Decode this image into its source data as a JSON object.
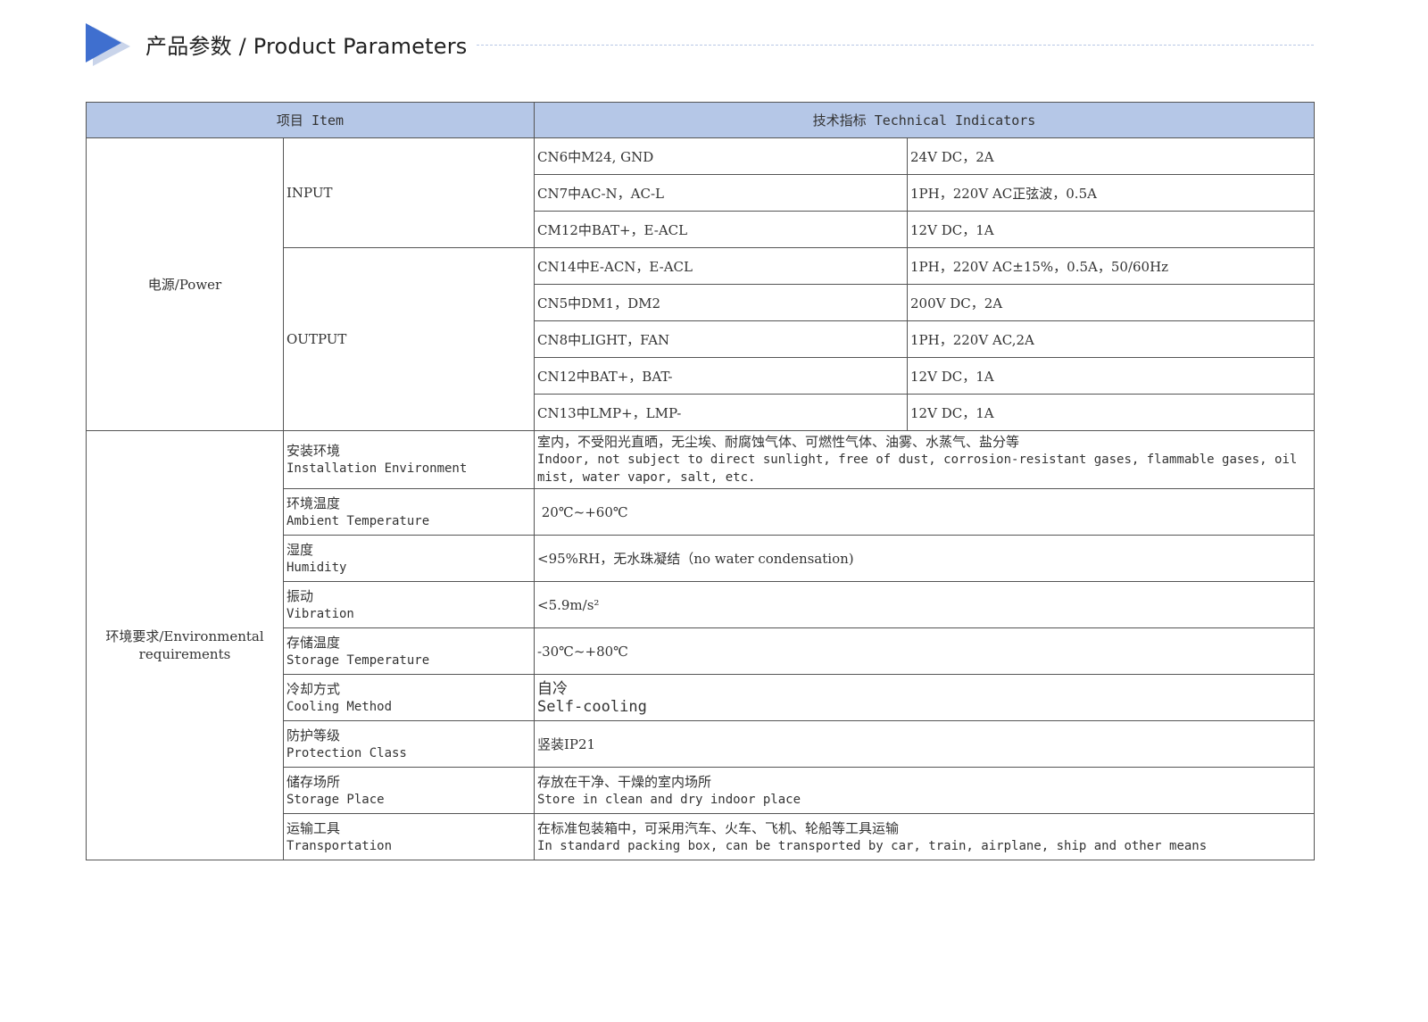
{
  "header": {
    "title": "产品参数 / Product Parameters",
    "accent": "#3f6fcf"
  },
  "table": {
    "col_item": "项目 Item",
    "col_tech": "技术指标 Technical Indicators",
    "header_bg": "#b5c7e7",
    "power": {
      "category": "电源/Power",
      "input_label": "INPUT",
      "output_label": "OUTPUT",
      "input_rows": [
        {
          "port": "CN6中M24, GND",
          "spec": "24V DC，2A"
        },
        {
          "port": "CN7中AC-N，AC-L",
          "spec": "1PH，220V AC正弦波，0.5A"
        },
        {
          "port": "CM12中BAT+，E-ACL",
          "spec": "12V DC，1A"
        }
      ],
      "output_rows": [
        {
          "port": "CN14中E-ACN，E-ACL",
          "spec": "1PH，220V AC±15%，0.5A，50/60Hz"
        },
        {
          "port": "CN5中DM1，DM2",
          "spec": "200V DC，2A"
        },
        {
          "port": "CN8中LIGHT，FAN",
          "spec": "1PH，220V AC,2A"
        },
        {
          "port": "CN12中BAT+，BAT-",
          "spec": "12V DC，1A"
        },
        {
          "port": "CN13中LMP+，LMP-",
          "spec": "12V DC，1A"
        }
      ]
    },
    "env": {
      "category_line1": "环境要求/Environmental",
      "category_line2": "requirements",
      "rows": [
        {
          "cn": "安装环境",
          "en": "Installation Environment",
          "v1": "室内，不受阳光直晒，无尘埃、耐腐蚀气体、可燃性气体、油雾、水蒸气、盐分等",
          "v2": "Indoor, not subject to direct sunlight, free of dust, corrosion-resistant gases, flammable gases, oil",
          "v3": "mist, water vapor, salt, etc."
        },
        {
          "cn": "环境温度",
          "en": "Ambient Temperature",
          "v1": " 20℃~+60℃"
        },
        {
          "cn": "湿度",
          "en": "Humidity",
          "v1": "<95%RH，无水珠凝结（no water condensation)"
        },
        {
          "cn": "振动",
          "en": "Vibration",
          "v1": "<5.9m/s²"
        },
        {
          "cn": "存储温度",
          "en": "Storage Temperature",
          "v1": "-30℃~+80℃"
        },
        {
          "cn": "冷却方式",
          "en": "Cooling Method",
          "v1": "自冷",
          "v2": "Self-cooling"
        },
        {
          "cn": "防护等级",
          "en": "Protection Class",
          "v1": "竖装IP21"
        },
        {
          "cn": "储存场所",
          "en": "Storage Place",
          "v1": "存放在干净、干燥的室内场所",
          "v2": "Store in clean and dry indoor place"
        },
        {
          "cn": "运输工具",
          "en": "Transportation",
          "v1": "在标准包装箱中，可采用汽车、火车、飞机、轮船等工具运输",
          "v2": "In standard packing box, can be transported by car, train, airplane, ship and other means"
        }
      ]
    }
  }
}
